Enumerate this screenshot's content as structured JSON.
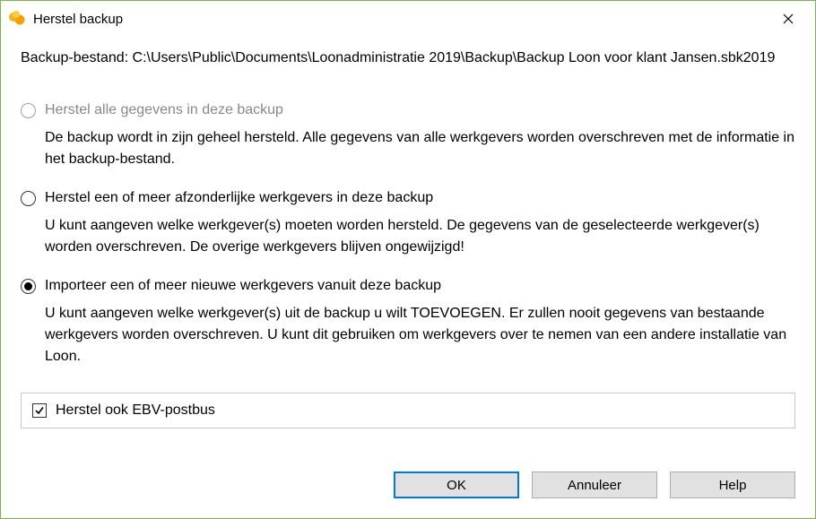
{
  "titlebar": {
    "title": "Herstel backup"
  },
  "file_info": "Backup-bestand: C:\\Users\\Public\\Documents\\Loonadministratie 2019\\Backup\\Backup Loon voor klant Jansen.sbk2019",
  "options": {
    "all": {
      "label": "Herstel alle gegevens in deze backup",
      "desc": "De backup wordt in zijn geheel hersteld. Alle gegevens van alle werkgevers worden overschreven met de informatie in het backup-bestand.",
      "enabled": false,
      "selected": false
    },
    "some": {
      "label": "Herstel een of meer afzonderlijke werkgevers in deze backup",
      "desc": "U kunt aangeven welke werkgever(s) moeten worden hersteld. De gegevens van de geselecteerde werkgever(s) worden overschreven. De overige werkgevers blijven ongewijzigd!",
      "enabled": true,
      "selected": false
    },
    "import": {
      "label": "Importeer een of meer nieuwe werkgevers vanuit deze backup",
      "desc": "U kunt aangeven welke werkgever(s) uit de backup u wilt TOEVOEGEN. Er zullen nooit gegevens van bestaande werkgevers worden overschreven. U kunt dit gebruiken om werkgevers over te nemen van een andere installatie van Loon.",
      "enabled": true,
      "selected": true
    }
  },
  "checkbox": {
    "label": "Herstel ook EBV-postbus",
    "checked": true
  },
  "buttons": {
    "ok": "OK",
    "cancel": "Annuleer",
    "help": "Help"
  }
}
